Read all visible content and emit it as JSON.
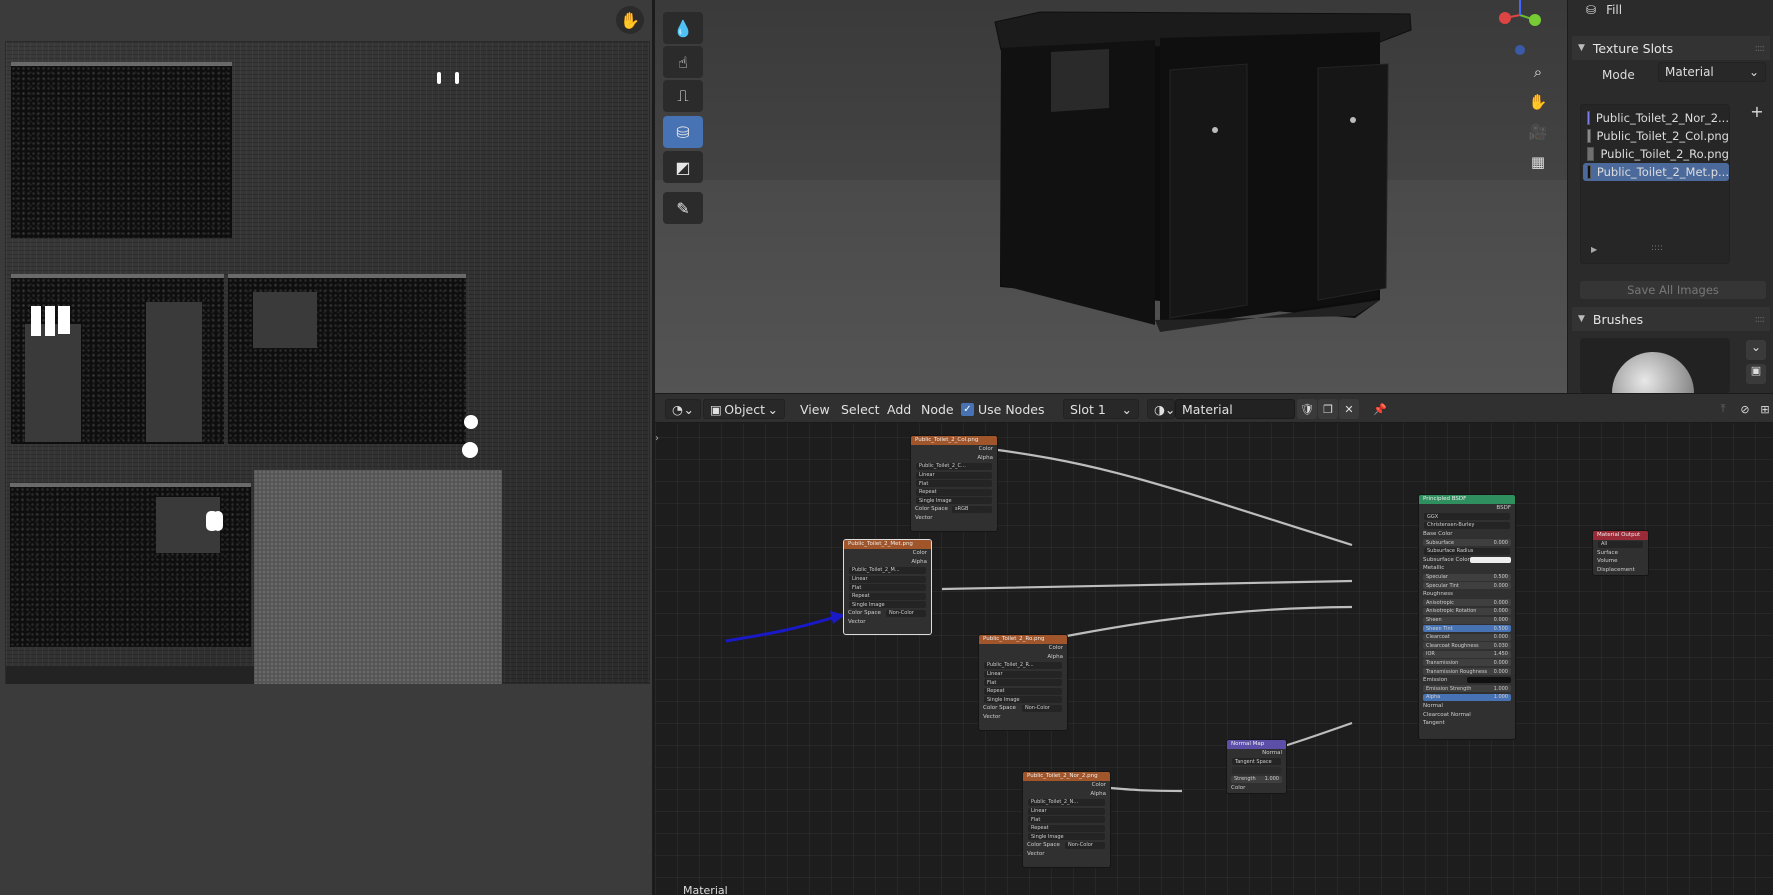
{
  "image_editor": {
    "hand_tool_icon": "hand-icon"
  },
  "viewport": {
    "tools": [
      "drop-icon",
      "smear-icon",
      "clone-icon",
      "fill-icon",
      "mask-icon",
      "annotate-icon"
    ],
    "nav_icons": [
      "zoom-icon",
      "hand-icon",
      "camera-icon",
      "grid-icon"
    ]
  },
  "properties": {
    "fill_label": "Fill",
    "texture_slots": {
      "title": "Texture Slots",
      "mode_label": "Mode",
      "mode_value": "Material",
      "slots": [
        {
          "name": "Public_Toilet_2_Nor_2...",
          "color": "#7f7ff2"
        },
        {
          "name": "Public_Toilet_2_Col.png",
          "color": "#8a8a8a"
        },
        {
          "name": "Public_Toilet_2_Ro.png",
          "color": "#707070"
        },
        {
          "name": "Public_Toilet_2_Met.p...",
          "color": "#111111"
        }
      ],
      "save_all": "Save All Images"
    },
    "brushes": {
      "title": "Brushes"
    }
  },
  "node_header": {
    "mode": "Object",
    "menu": [
      "View",
      "Select",
      "Add",
      "Node"
    ],
    "use_nodes": "Use Nodes",
    "slot": "Slot 1",
    "material": "Material"
  },
  "nodes": {
    "col": {
      "title": "Public_Toilet_2_Col.png",
      "out": [
        "Color",
        "Alpha"
      ],
      "image": "Public_Toilet_2_C...",
      "opts": [
        "Linear",
        "Flat",
        "Repeat",
        "Single Image"
      ],
      "cs_label": "Color Space",
      "cs_value": "sRGB",
      "vector": "Vector"
    },
    "met": {
      "title": "Public_Toilet_2_Met.png",
      "out": [
        "Color",
        "Alpha"
      ],
      "image": "Public_Toilet_2_M...",
      "opts": [
        "Linear",
        "Flat",
        "Repeat",
        "Single Image"
      ],
      "cs_label": "Color Space",
      "cs_value": "Non-Color",
      "vector": "Vector"
    },
    "ro": {
      "title": "Public_Toilet_2_Ro.png",
      "out": [
        "Color",
        "Alpha"
      ],
      "image": "Public_Toilet_2_R...",
      "opts": [
        "Linear",
        "Flat",
        "Repeat",
        "Single Image"
      ],
      "cs_label": "Color Space",
      "cs_value": "Non-Color",
      "vector": "Vector"
    },
    "nor": {
      "title": "Public_Toilet_2_Nor_2.png",
      "out": [
        "Color",
        "Alpha"
      ],
      "image": "Public_Toilet_2_N...",
      "opts": [
        "Linear",
        "Flat",
        "Repeat",
        "Single Image"
      ],
      "cs_label": "Color Space",
      "cs_value": "Non-Color",
      "vector": "Vector"
    },
    "normal_map": {
      "title": "Normal Map",
      "out": "Normal",
      "space": "Tangent Space",
      "strength_label": "Strength",
      "strength_value": "1.000",
      "color": "Color"
    },
    "bsdf": {
      "title": "Principled BSDF",
      "out": "BSDF",
      "dist": "GGX",
      "sss": "Christensen-Burley",
      "base_color": "Base Color",
      "rows": [
        {
          "label": "Subsurface",
          "value": "0.000"
        },
        {
          "label": "Subsurface Radius",
          "value": ""
        },
        {
          "label": "Subsurface Color",
          "value": ""
        },
        {
          "label": "Metallic",
          "value": ""
        },
        {
          "label": "Specular",
          "value": "0.500"
        },
        {
          "label": "Specular Tint",
          "value": "0.000"
        },
        {
          "label": "Roughness",
          "value": ""
        },
        {
          "label": "Anisotropic",
          "value": "0.000"
        },
        {
          "label": "Anisotropic Rotation",
          "value": "0.000"
        },
        {
          "label": "Sheen",
          "value": "0.000"
        },
        {
          "label": "Sheen Tint",
          "value": "0.500"
        },
        {
          "label": "Clearcoat",
          "value": "0.000"
        },
        {
          "label": "Clearcoat Roughness",
          "value": "0.030"
        },
        {
          "label": "IOR",
          "value": "1.450"
        },
        {
          "label": "Transmission",
          "value": "0.000"
        },
        {
          "label": "Transmission Roughness",
          "value": "0.000"
        },
        {
          "label": "Emission",
          "value": ""
        },
        {
          "label": "Emission Strength",
          "value": "1.000"
        },
        {
          "label": "Alpha",
          "value": "1.000"
        },
        {
          "label": "Normal",
          "value": ""
        },
        {
          "label": "Clearcoat Normal",
          "value": ""
        },
        {
          "label": "Tangent",
          "value": ""
        }
      ]
    },
    "output": {
      "title": "Material Output",
      "target": "All",
      "inputs": [
        "Surface",
        "Volume",
        "Displacement"
      ]
    }
  },
  "footer": "Material"
}
